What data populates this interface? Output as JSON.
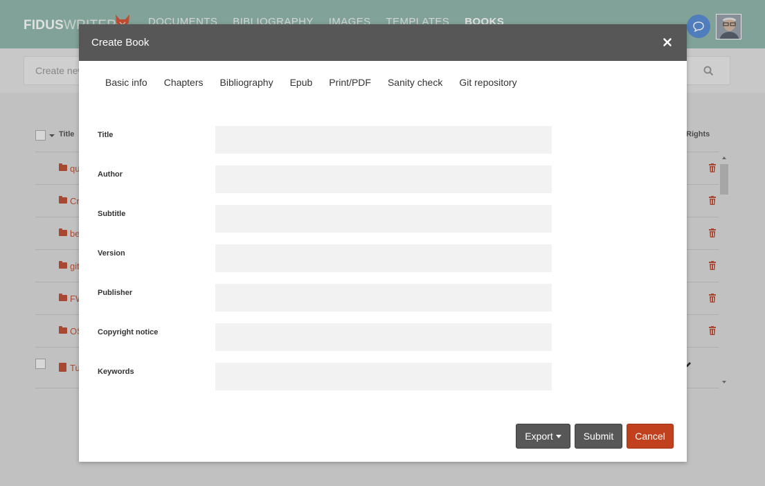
{
  "app": {
    "logo_bold": "FIDUS",
    "logo_thin": "WRITER",
    "nav": [
      "DOCUMENTS",
      "BIBLIOGRAPHY",
      "IMAGES",
      "TEMPLATES",
      "BOOKS"
    ],
    "active_nav": "BOOKS"
  },
  "toolbar": {
    "create_placeholder": "Create new book"
  },
  "list": {
    "header_title": "Title",
    "header_rights": "Rights",
    "rows": [
      {
        "label": "qu",
        "type": "folder"
      },
      {
        "label": "Cr",
        "type": "folder"
      },
      {
        "label": "be",
        "type": "folder"
      },
      {
        "label": "git",
        "type": "folder"
      },
      {
        "label": "FW",
        "type": "folder"
      },
      {
        "label": "OS",
        "type": "folder"
      },
      {
        "label": "Tul",
        "type": "book"
      }
    ]
  },
  "dialog": {
    "title": "Create Book",
    "tabs": [
      "Basic info",
      "Chapters",
      "Bibliography",
      "Epub",
      "Print/PDF",
      "Sanity check",
      "Git repository"
    ],
    "fields": [
      {
        "label": "Title",
        "value": ""
      },
      {
        "label": "Author",
        "value": ""
      },
      {
        "label": "Subtitle",
        "value": ""
      },
      {
        "label": "Version",
        "value": ""
      },
      {
        "label": "Publisher",
        "value": ""
      },
      {
        "label": "Copyright notice",
        "value": ""
      },
      {
        "label": "Keywords",
        "value": ""
      }
    ],
    "buttons": {
      "export": "Export",
      "submit": "Submit",
      "cancel": "Cancel"
    }
  },
  "colors": {
    "topbar": "#93b9ad",
    "accent_red": "#c0533a",
    "cancel_button": "#c1401d",
    "dialog_header": "#575757"
  }
}
